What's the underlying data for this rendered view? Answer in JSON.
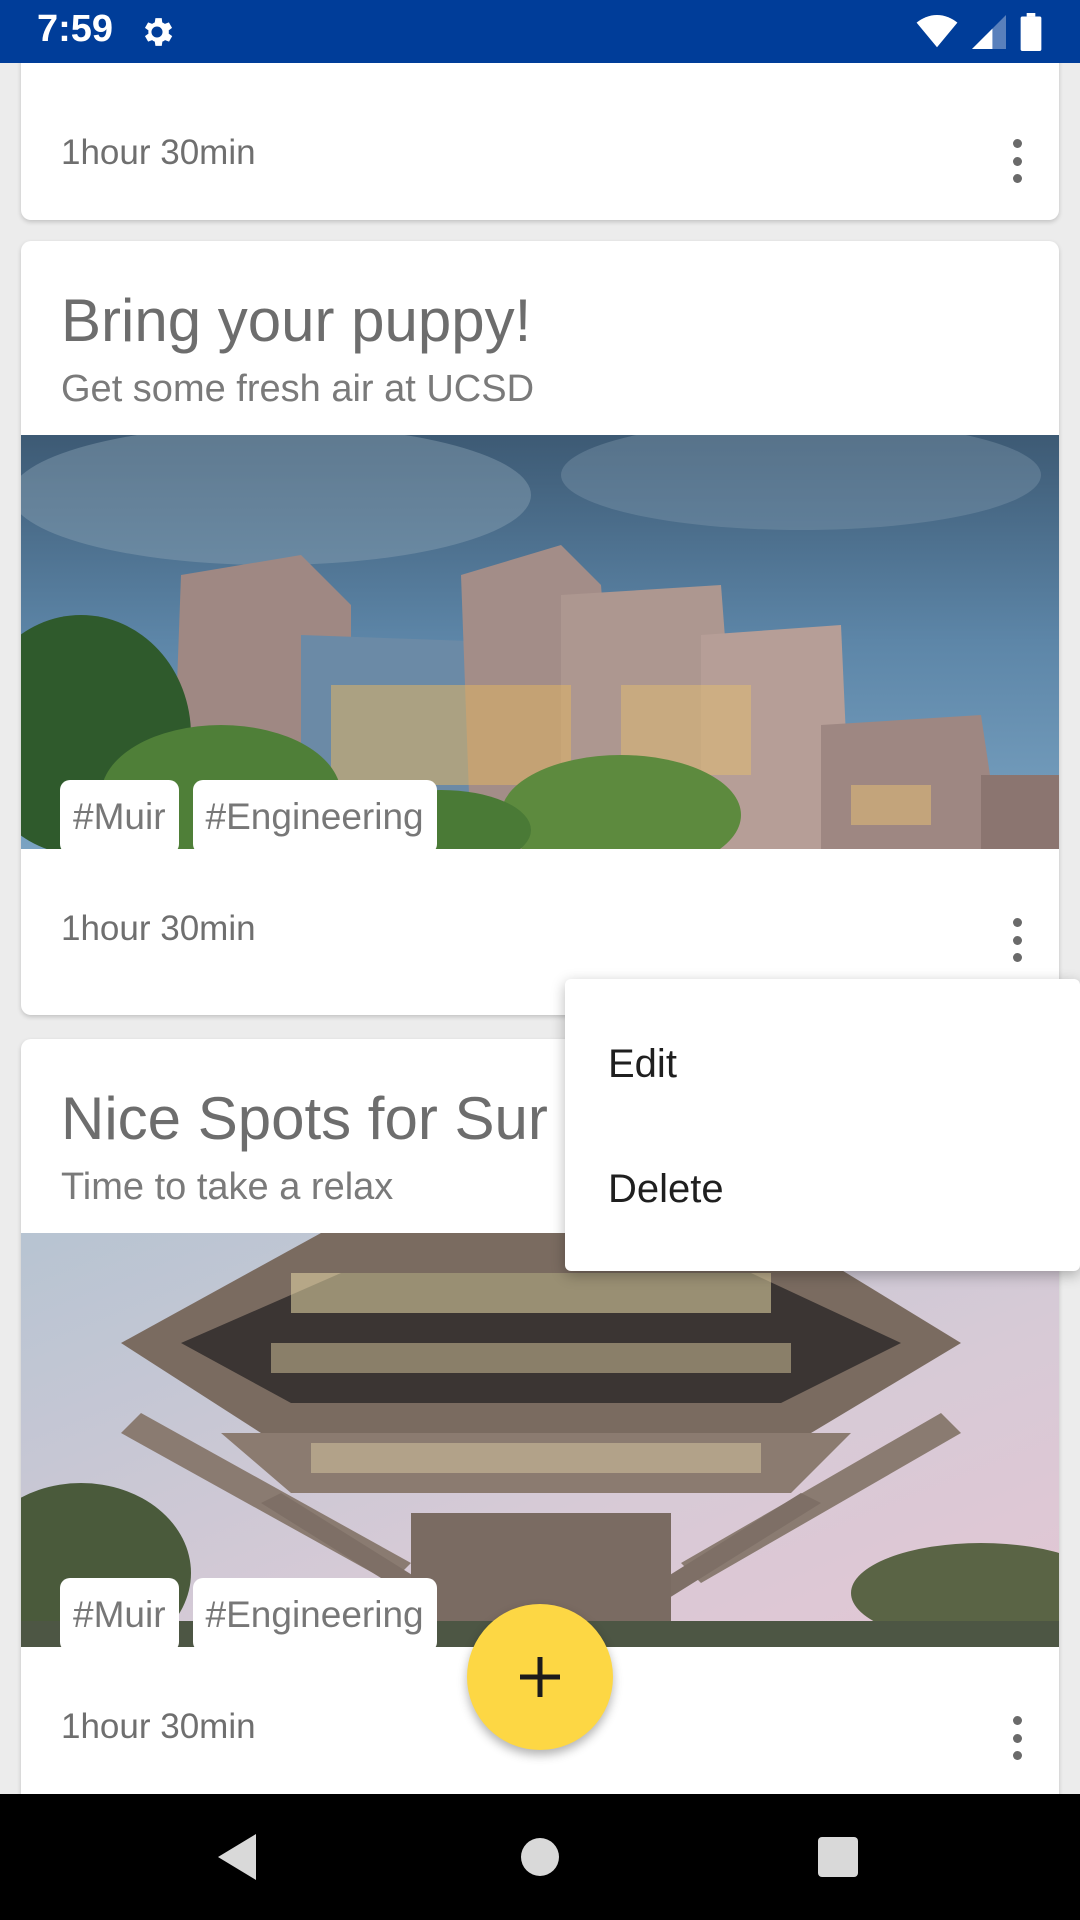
{
  "status_bar": {
    "time": "7:59"
  },
  "cards": [
    {
      "duration": "1hour 30min"
    },
    {
      "title": "Bring your puppy!",
      "subtitle": "Get some fresh air at UCSD",
      "tags": [
        "#Muir",
        "#Engineering"
      ],
      "duration": "1hour 30min"
    },
    {
      "title": "Nice Spots for Sur",
      "subtitle": "Time to take a relax",
      "tags": [
        "#Muir",
        "#Engineering"
      ],
      "duration": "1hour 30min"
    }
  ],
  "menu": {
    "edit": "Edit",
    "delete": "Delete"
  },
  "colors": {
    "status_bar": "#003d99",
    "fab": "#fdd744",
    "nav_bar": "#000000"
  },
  "icons": {
    "status_left": "gear-icon",
    "status_right": [
      "wifi-icon",
      "signal-icon",
      "battery-icon"
    ],
    "card_action": "more-vert-icon",
    "fab": "plus-icon",
    "nav": [
      "back-icon",
      "home-icon",
      "recents-icon"
    ]
  }
}
